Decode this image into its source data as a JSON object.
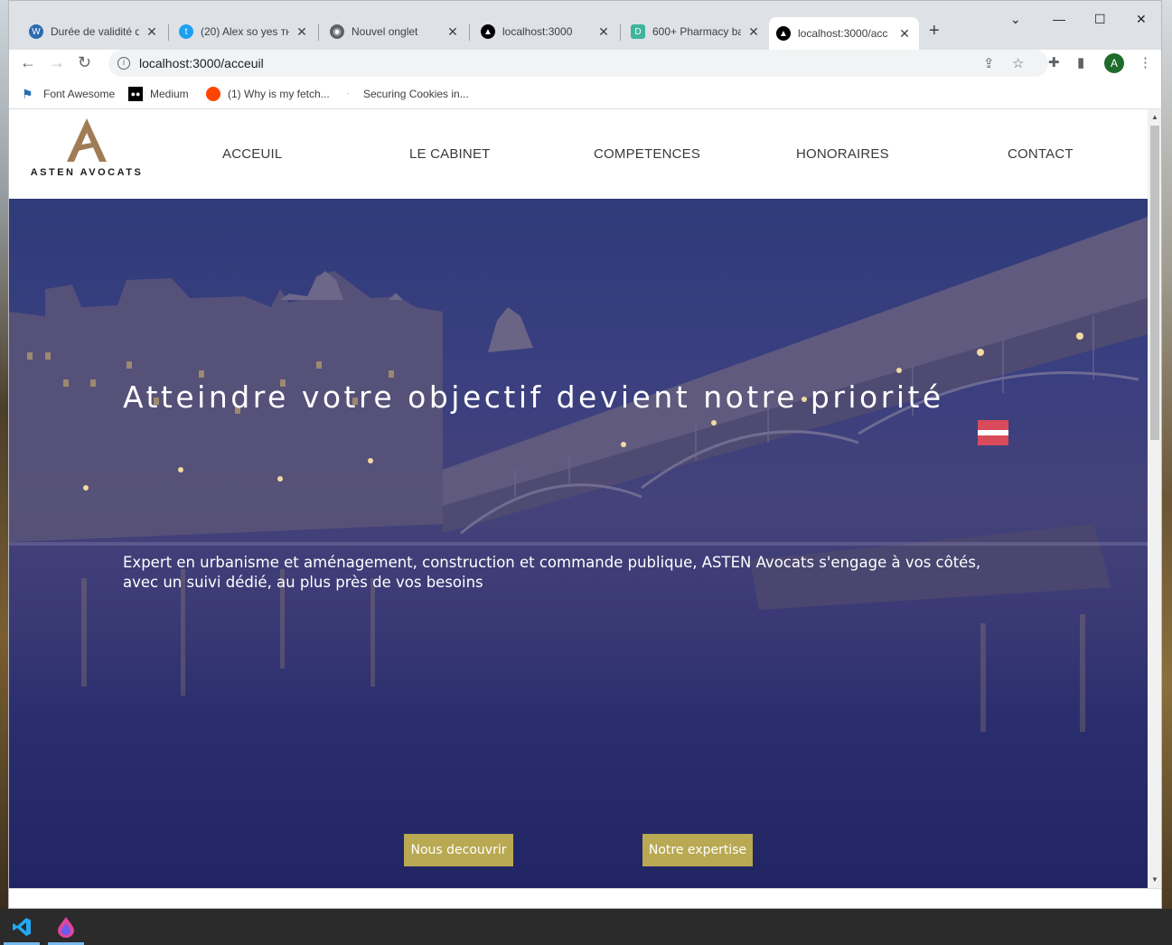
{
  "browser": {
    "tabs": [
      {
        "title": "Durée de validité d",
        "icon": "wordpress-icon",
        "color": "#2b6cb0"
      },
      {
        "title": "(20) Alex so yes ᴛʜ",
        "icon": "twitter-icon",
        "color": "#1da1f2"
      },
      {
        "title": "Nouvel onglet",
        "icon": "chrome-icon",
        "color": "#5f6368"
      },
      {
        "title": "localhost:3000",
        "icon": "nextjs-icon",
        "color": "#000000"
      },
      {
        "title": "600+ Pharmacy ba",
        "icon": "dribbble-d-icon",
        "color": "#3fb59e"
      },
      {
        "title": "localhost:3000/acc",
        "icon": "nextjs-icon",
        "color": "#000000",
        "active": true
      }
    ],
    "url": "localhost:3000/acceuil",
    "bookmarks": [
      {
        "label": "Font Awesome",
        "icon": "flag-icon"
      },
      {
        "label": "Medium",
        "icon": "medium-icon"
      },
      {
        "label": "(1) Why is my fetch...",
        "icon": "reddit-icon"
      },
      {
        "label": "Securing Cookies in...",
        "icon": "dot-icon"
      }
    ],
    "avatar_letter": "A"
  },
  "site": {
    "brand": "ASTEN AVOCATS",
    "nav": [
      "ACCEUIL",
      "LE CABINET",
      "COMPETENCES",
      "HONORAIRES",
      "CONTACT"
    ],
    "hero": {
      "title": "Atteindre votre objectif devient notre priorité",
      "subtitle": "Expert en urbanisme et aménagement, construction et commande publique, ASTEN Avocats s'engage à vos côtés, avec un suivi dédié, au plus près de vos besoins",
      "buttons": [
        "Nous decouvrir",
        "Notre expertise"
      ]
    },
    "colors": {
      "accent": "#b8a952",
      "logo": "#a07c55"
    }
  }
}
